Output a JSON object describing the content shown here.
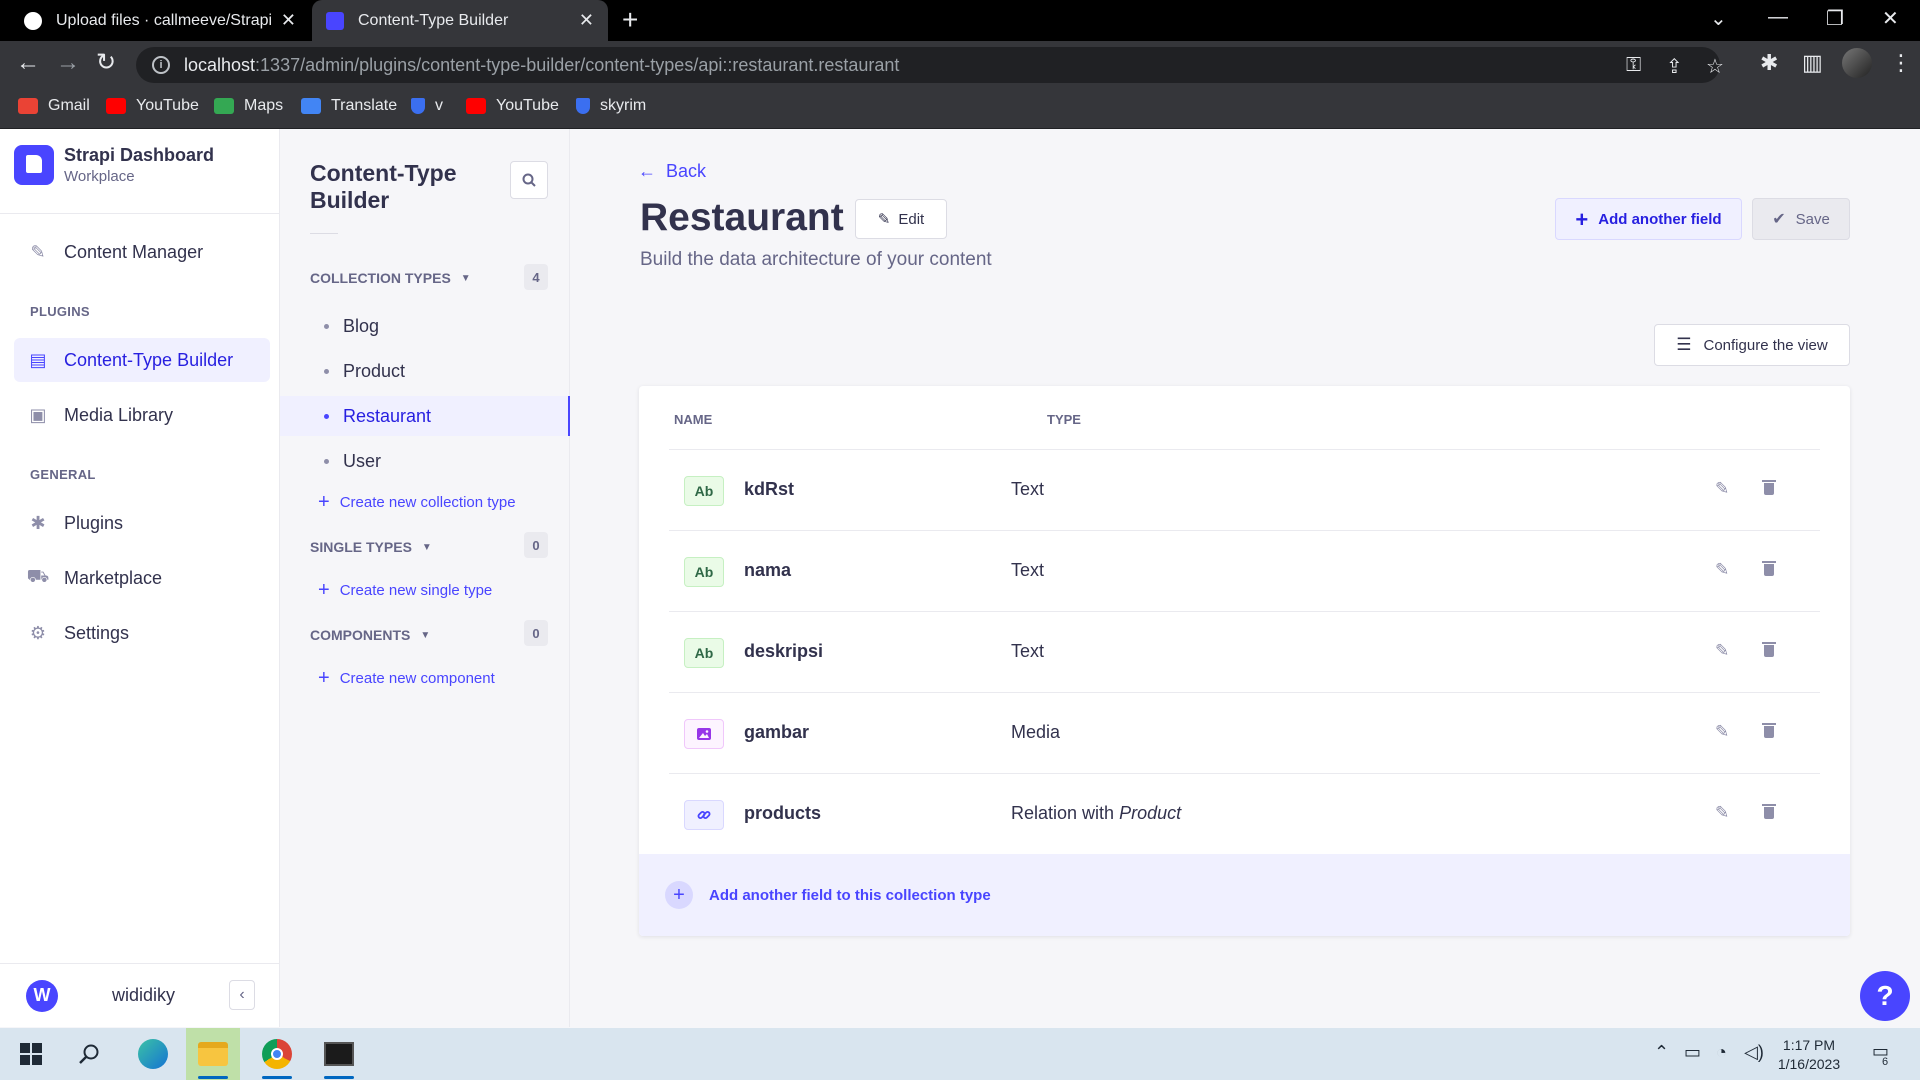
{
  "browser": {
    "tabs": [
      {
        "title": "Upload files · callmeeve/Strapi-Pr",
        "active": false
      },
      {
        "title": "Content-Type Builder",
        "active": true
      }
    ],
    "url_host": "localhost",
    "url_rest": ":1337/admin/plugins/content-type-builder/content-types/api::restaurant.restaurant",
    "bookmarks": [
      {
        "label": "Gmail",
        "icon": "gmail-icon",
        "color": "#ea4335"
      },
      {
        "label": "YouTube",
        "icon": "youtube-icon",
        "color": "#ff0000"
      },
      {
        "label": "Maps",
        "icon": "maps-icon",
        "color": "#34a853"
      },
      {
        "label": "Translate",
        "icon": "translate-icon",
        "color": "#4285f4"
      },
      {
        "label": "v",
        "icon": "shield-icon",
        "color": "#3b6ff0"
      },
      {
        "label": "YouTube",
        "icon": "youtube-icon",
        "color": "#ff0000"
      },
      {
        "label": "skyrim",
        "icon": "shield-icon",
        "color": "#3b6ff0"
      }
    ]
  },
  "brand": {
    "title": "Strapi Dashboard",
    "subtitle": "Workplace"
  },
  "mainnav": {
    "content_manager": "Content Manager",
    "plugins_label": "PLUGINS",
    "content_type_builder": "Content-Type Builder",
    "media_library": "Media Library",
    "general_label": "GENERAL",
    "plugins": "Plugins",
    "marketplace": "Marketplace",
    "settings": "Settings",
    "user_initial": "W",
    "user_name": "wididiky"
  },
  "subnav": {
    "title": "Content-Type Builder",
    "collection_types_label": "COLLECTION TYPES",
    "collection_types_count": "4",
    "collection_types": [
      "Blog",
      "Product",
      "Restaurant",
      "User"
    ],
    "active_collection": "Restaurant",
    "create_collection": "Create new collection type",
    "single_types_label": "SINGLE TYPES",
    "single_types_count": "0",
    "create_single": "Create new single type",
    "components_label": "COMPONENTS",
    "components_count": "0",
    "create_component": "Create new component"
  },
  "content": {
    "back": "Back",
    "title": "Restaurant",
    "edit": "Edit",
    "subtitle": "Build the data architecture of your content",
    "add_field": "Add another field",
    "save": "Save",
    "configure_view": "Configure the view",
    "columns": {
      "name": "NAME",
      "type": "TYPE"
    },
    "fields": [
      {
        "name": "kdRst",
        "type": "Text",
        "badge": "Ab",
        "kind": "text"
      },
      {
        "name": "nama",
        "type": "Text",
        "badge": "Ab",
        "kind": "text"
      },
      {
        "name": "deskripsi",
        "type": "Text",
        "badge": "Ab",
        "kind": "text"
      },
      {
        "name": "gambar",
        "type": "Media",
        "badge": "media-icon",
        "kind": "media"
      },
      {
        "name": "products",
        "type": "Relation with",
        "type_target": "Product",
        "badge": "link-icon",
        "kind": "relation"
      }
    ],
    "add_field_footer": "Add another field to this collection type",
    "help": "?"
  },
  "taskbar": {
    "time": "1:17 PM",
    "date": "1/16/2023",
    "notifications": "6"
  },
  "colors": {
    "primary": "#4945ff",
    "primary_light": "#f0f0ff",
    "text": "#32324d",
    "muted": "#666687"
  }
}
